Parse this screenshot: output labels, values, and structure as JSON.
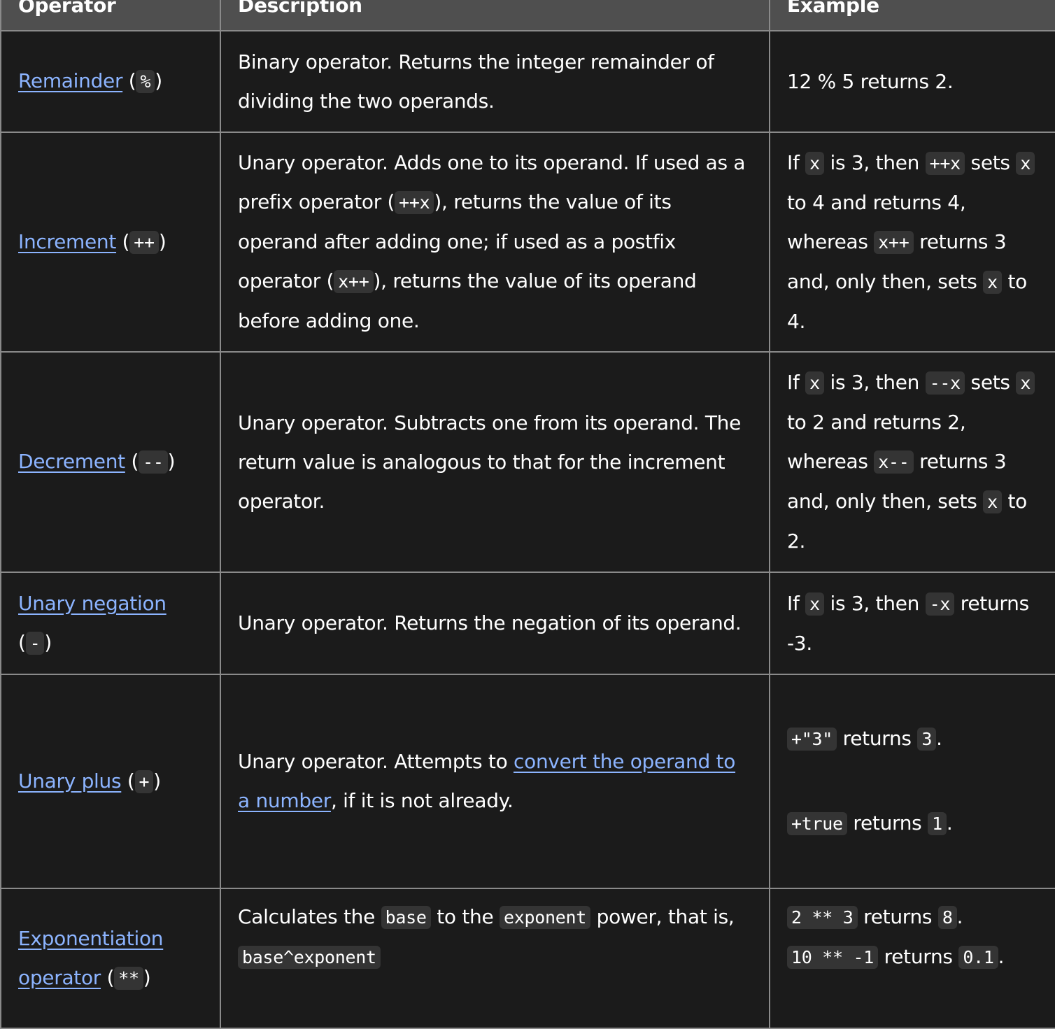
{
  "headers": [
    "Operator",
    "Description",
    "Example"
  ],
  "colors": {
    "background": "#1b1b1b",
    "header": "#4f4f4f",
    "link": "#8cb4ff",
    "code_bg": "#343434",
    "border": "#8a8a8a"
  },
  "rows": [
    {
      "operator": [
        {
          "k": "link",
          "t": "Remainder"
        },
        {
          "k": "text",
          "t": " ("
        },
        {
          "k": "code",
          "t": "%"
        },
        {
          "k": "text",
          "t": ")"
        }
      ],
      "description": [
        [
          {
            "k": "text",
            "t": "Binary operator. Returns the integer remainder of dividing the two operands."
          }
        ]
      ],
      "example": [
        [
          {
            "k": "text",
            "t": "12 % 5 returns 2."
          }
        ]
      ]
    },
    {
      "operator": [
        {
          "k": "link",
          "t": "Increment"
        },
        {
          "k": "text",
          "t": " ("
        },
        {
          "k": "code",
          "t": "++"
        },
        {
          "k": "text",
          "t": ")"
        }
      ],
      "description": [
        [
          {
            "k": "text",
            "t": "Unary operator. Adds one to its operand. If used as a prefix operator ("
          },
          {
            "k": "code",
            "t": "++x"
          },
          {
            "k": "text",
            "t": "), returns the value of its operand after adding one; if used as a postfix operator ("
          },
          {
            "k": "code",
            "t": "x++"
          },
          {
            "k": "text",
            "t": "), returns the value of its operand before adding one."
          }
        ]
      ],
      "example": [
        [
          {
            "k": "text",
            "t": "If "
          },
          {
            "k": "code",
            "t": "x"
          },
          {
            "k": "text",
            "t": " is 3, then "
          },
          {
            "k": "code",
            "t": "++x"
          },
          {
            "k": "text",
            "t": " sets "
          },
          {
            "k": "code",
            "t": "x"
          },
          {
            "k": "text",
            "t": " to 4 and returns 4, whereas "
          },
          {
            "k": "code",
            "t": "x++"
          },
          {
            "k": "text",
            "t": " returns 3 and, only then, sets "
          },
          {
            "k": "code",
            "t": "x"
          },
          {
            "k": "text",
            "t": " to 4."
          }
        ]
      ]
    },
    {
      "operator": [
        {
          "k": "link",
          "t": "Decrement"
        },
        {
          "k": "text",
          "t": " ("
        },
        {
          "k": "code",
          "t": "--"
        },
        {
          "k": "text",
          "t": ")"
        }
      ],
      "description": [
        [
          {
            "k": "text",
            "t": "Unary operator. Subtracts one from its operand. The return value is analogous to that for the increment operator."
          }
        ]
      ],
      "example": [
        [
          {
            "k": "text",
            "t": "If "
          },
          {
            "k": "code",
            "t": "x"
          },
          {
            "k": "text",
            "t": " is 3, then "
          },
          {
            "k": "code",
            "t": "--x"
          },
          {
            "k": "text",
            "t": " sets "
          },
          {
            "k": "code",
            "t": "x"
          },
          {
            "k": "text",
            "t": " to 2 and returns 2, whereas "
          },
          {
            "k": "code",
            "t": "x--"
          },
          {
            "k": "text",
            "t": " returns 3 and, only then, sets "
          },
          {
            "k": "code",
            "t": "x"
          },
          {
            "k": "text",
            "t": " to 2."
          }
        ]
      ]
    },
    {
      "operator": [
        {
          "k": "link",
          "t": "Unary negation"
        },
        {
          "k": "text",
          "t": " ("
        },
        {
          "k": "code",
          "t": "-"
        },
        {
          "k": "text",
          "t": ")"
        }
      ],
      "description": [
        [
          {
            "k": "text",
            "t": "Unary operator. Returns the negation of its operand."
          }
        ]
      ],
      "example": [
        [
          {
            "k": "text",
            "t": "If "
          },
          {
            "k": "code",
            "t": "x"
          },
          {
            "k": "text",
            "t": " is 3, then "
          },
          {
            "k": "code",
            "t": "-x"
          },
          {
            "k": "text",
            "t": " returns -3."
          }
        ]
      ]
    },
    {
      "operator": [
        {
          "k": "link",
          "t": "Unary plus"
        },
        {
          "k": "text",
          "t": " ("
        },
        {
          "k": "code",
          "t": "+"
        },
        {
          "k": "text",
          "t": ")"
        }
      ],
      "description": [
        [
          {
            "k": "text",
            "t": "Unary operator. Attempts to "
          },
          {
            "k": "link",
            "t": "convert the operand to a number"
          },
          {
            "k": "text",
            "t": ", if it is not already."
          }
        ]
      ],
      "example": [
        [
          {
            "k": "code",
            "t": "+\"3\""
          },
          {
            "k": "text",
            "t": " returns "
          },
          {
            "k": "code",
            "t": "3"
          },
          {
            "k": "text",
            "t": "."
          }
        ],
        [
          {
            "k": "code",
            "t": "+true"
          },
          {
            "k": "text",
            "t": " returns "
          },
          {
            "k": "code",
            "t": "1"
          },
          {
            "k": "text",
            "t": "."
          }
        ]
      ]
    },
    {
      "operator": [
        {
          "k": "link",
          "t": "Exponentiation operator"
        },
        {
          "k": "text",
          "t": " ("
        },
        {
          "k": "code",
          "t": "**"
        },
        {
          "k": "text",
          "t": ")"
        }
      ],
      "description": [
        [
          {
            "k": "text",
            "t": "Calculates the "
          },
          {
            "k": "code",
            "t": "base"
          },
          {
            "k": "text",
            "t": " to the "
          },
          {
            "k": "code",
            "t": "exponent"
          },
          {
            "k": "text",
            "t": " power, that is, "
          },
          {
            "k": "code",
            "t": "base^exponent"
          }
        ]
      ],
      "example": [
        [
          {
            "k": "code",
            "t": "2 ** 3"
          },
          {
            "k": "text",
            "t": " returns "
          },
          {
            "k": "code",
            "t": "8"
          },
          {
            "k": "text",
            "t": "."
          }
        ],
        [
          {
            "k": "code",
            "t": "10 ** -1"
          },
          {
            "k": "text",
            "t": " returns "
          },
          {
            "k": "code",
            "t": "0.1"
          },
          {
            "k": "text",
            "t": "."
          }
        ]
      ]
    }
  ]
}
